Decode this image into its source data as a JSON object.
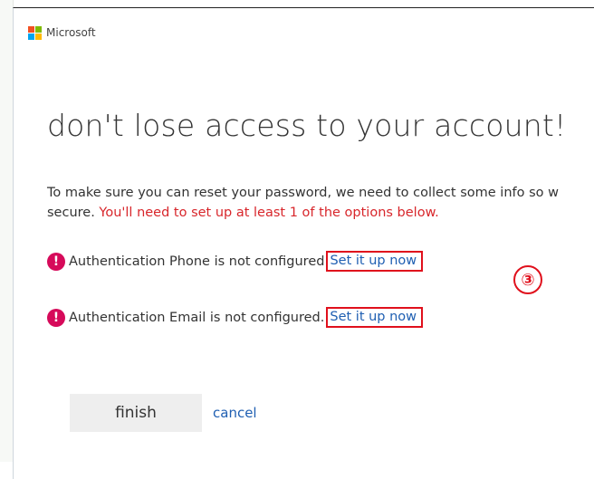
{
  "header": {
    "brand": "Microsoft",
    "logo_colors": [
      "#f25022",
      "#7fba00",
      "#00a4ef",
      "#ffb900"
    ]
  },
  "title": "don't lose access to your account!",
  "intro": {
    "line1": "To make sure you can reset your password, we need to collect some info so w",
    "line2_prefix": "secure. ",
    "line2_warning": "You'll need to set up at least 1 of the options below."
  },
  "options": [
    {
      "status": "Authentication Phone is not configured",
      "link": "Set it up now"
    },
    {
      "status": "Authentication Email is not configured.",
      "link": "Set it up now"
    }
  ],
  "step_marker": "③",
  "actions": {
    "finish": "finish",
    "cancel": "cancel"
  },
  "colors": {
    "accent_link": "#1f5fb2",
    "warning": "#d8262b",
    "alert_icon": "#d60a5a",
    "highlight": "#e0101c"
  }
}
